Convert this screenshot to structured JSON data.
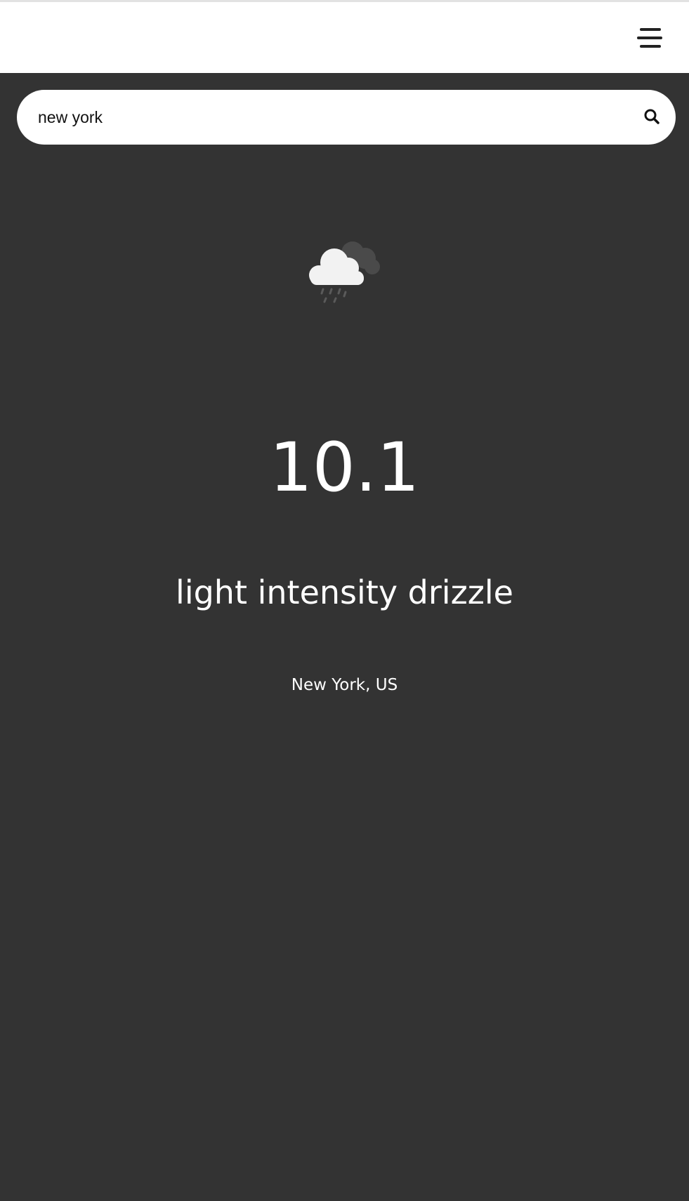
{
  "header": {
    "menu_icon": "hamburger-menu-icon"
  },
  "search": {
    "value": "new york",
    "icon": "search-icon"
  },
  "weather": {
    "icon": "cloud-drizzle-icon",
    "temperature": "10.1",
    "description": "light intensity drizzle",
    "location": "New York, US"
  },
  "colors": {
    "background": "#333333",
    "header_background": "#ffffff",
    "text": "#ffffff"
  }
}
